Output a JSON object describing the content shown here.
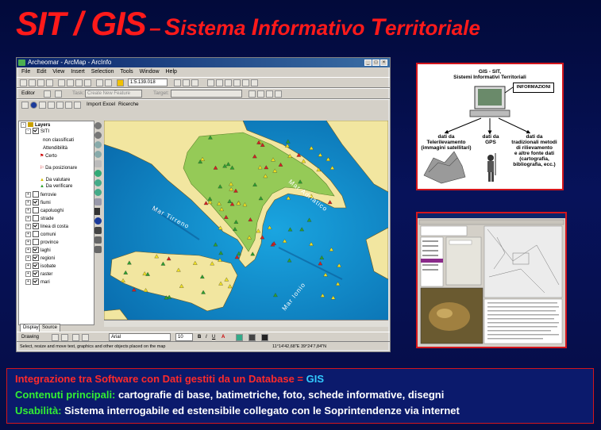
{
  "title": {
    "main": "SIT / GIS",
    "dash": "–",
    "sub_parts": [
      "S",
      "istema ",
      "I",
      "nformativo ",
      "T",
      "erritoriale"
    ]
  },
  "arcmap": {
    "window_title": "Archeomar - ArcMap - ArcInfo",
    "menu": [
      "File",
      "Edit",
      "View",
      "Insert",
      "Selection",
      "Tools",
      "Window",
      "Help"
    ],
    "scale": "1:5.139.018",
    "editor_label": "Editor",
    "task_label": "Task:",
    "task_value": "Create New Feature",
    "target_label": "Target:",
    "import_excel": "Import Excel",
    "ricerche": "Ricerche",
    "toc": {
      "root": "Layers",
      "group": "SITI",
      "sub": [
        "non classificati",
        "Attendibilità",
        "Certo",
        "Da posizionare",
        "Da valutare",
        "Da verificare"
      ],
      "layers": [
        {
          "name": "ferrovie",
          "on": false
        },
        {
          "name": "fiumi",
          "on": true
        },
        {
          "name": "capoluoghi",
          "on": false
        },
        {
          "name": "strade",
          "on": false
        },
        {
          "name": "linea di costa",
          "on": true
        },
        {
          "name": "comuni",
          "on": false
        },
        {
          "name": "province",
          "on": false
        },
        {
          "name": "laghi",
          "on": true
        },
        {
          "name": "regioni",
          "on": true
        },
        {
          "name": "isobate",
          "on": true
        },
        {
          "name": "raster",
          "on": true
        },
        {
          "name": "mari",
          "on": true
        }
      ],
      "tabs": [
        "Display",
        "Source"
      ]
    },
    "map_labels": {
      "adriatico": "Mar Adriatico",
      "tirreno": "Mar Tirreno",
      "ionio": "Mar Ionio"
    },
    "drawing_label": "Drawing",
    "font_name": "Arial",
    "font_size": "10",
    "status_text": "Select, resize and move text, graphics and other objects placed on the map",
    "coords": "11°14'42,68\"E  39°24'7,84\"N"
  },
  "diagram": {
    "title_line1": "GIS - SIT,",
    "title_line2": "Sistemi Informativi Territoriali",
    "info_box": "INFORMAZIONI",
    "col1": [
      "dati da",
      "Telerilevamento",
      "(immagini satellitari)"
    ],
    "col2": [
      "dati da",
      "GPS"
    ],
    "col3": [
      "dati da",
      "tradizionali metodi",
      "di rilievamento",
      "e altre fonte dati",
      "(cartografia,",
      "bibliografia, ecc.)"
    ]
  },
  "info": {
    "line1_prefix": "Integrazione tra Software con Dati gestiti da un Database = ",
    "line1_gis": "GIS",
    "line2_label": "Contenuti principali:",
    "line2_text": " cartografie di base, batimetriche, foto, schede informative, disegni",
    "line3_label": "Usabilità:",
    "line3_text": " Sistema interrogabile ed estensibile collegato con le Soprintendenze via internet"
  },
  "colors": {
    "title_red": "#ff1a1a",
    "gis_cyan": "#33ccff",
    "label_green": "#33ee33",
    "sea": "#0a8fd0",
    "land": "#f3e9a8",
    "border_red": "#d4161c"
  }
}
